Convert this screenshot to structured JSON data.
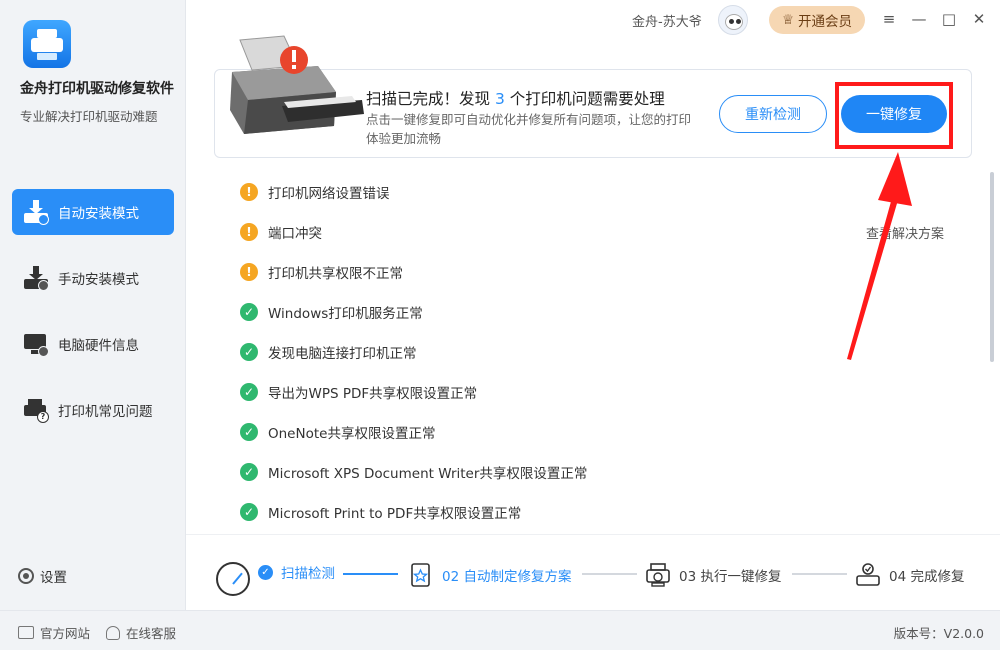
{
  "app": {
    "title": "金舟打印机驱动修复软件",
    "subtitle": "专业解决打印机驱动难题"
  },
  "sidebar": {
    "items": [
      {
        "label": "自动安装模式",
        "icon": "printer-download-icon",
        "active": true
      },
      {
        "label": "手动安装模式",
        "icon": "printer-download-icon",
        "active": false
      },
      {
        "label": "电脑硬件信息",
        "icon": "monitor-info-icon",
        "active": false
      },
      {
        "label": "打印机常见问题",
        "icon": "printer-question-icon",
        "active": false
      }
    ],
    "settings_label": "设置"
  },
  "topbar": {
    "username": "金舟-苏大爷",
    "vip_label": "开通会员",
    "controls": [
      "≡",
      "—",
      "□",
      "✕"
    ]
  },
  "scan": {
    "title_prefix": "扫描已完成！发现 ",
    "issue_count": "3",
    "title_suffix": " 个打印机问题需要处理",
    "description": "点击一键修复即可自动优化并修复所有问题项，让您的打印体验更加流畅",
    "rescan_label": "重新检测",
    "fix_label": "一键修复"
  },
  "issues": [
    {
      "status": "warn",
      "text": "打印机网络设置错误"
    },
    {
      "status": "warn",
      "text": "端口冲突",
      "action": "查看解决方案"
    },
    {
      "status": "warn",
      "text": "打印机共享权限不正常"
    },
    {
      "status": "ok",
      "text": "Windows打印机服务正常"
    },
    {
      "status": "ok",
      "text": "发现电脑连接打印机正常"
    },
    {
      "status": "ok",
      "text": "导出为WPS PDF共享权限设置正常"
    },
    {
      "status": "ok",
      "text": "OneNote共享权限设置正常"
    },
    {
      "status": "ok",
      "text": "Microsoft XPS Document Writer共享权限设置正常"
    },
    {
      "status": "ok",
      "text": "Microsoft Print to PDF共享权限设置正常"
    }
  ],
  "steps": [
    {
      "label": "扫描检测",
      "active": true
    },
    {
      "label": "02 自动制定修复方案",
      "active": true
    },
    {
      "label": "03 执行一键修复",
      "active": false
    },
    {
      "label": "04 完成修复",
      "active": false
    }
  ],
  "footer": {
    "website_label": "官方网站",
    "support_label": "在线客服",
    "version_label": "版本号：V2.0.0"
  },
  "colors": {
    "accent": "#2a8ef7",
    "warn": "#f5a623",
    "ok": "#2fb86f",
    "highlight": "#ff1a1a",
    "vip": "#f6d7b3"
  }
}
